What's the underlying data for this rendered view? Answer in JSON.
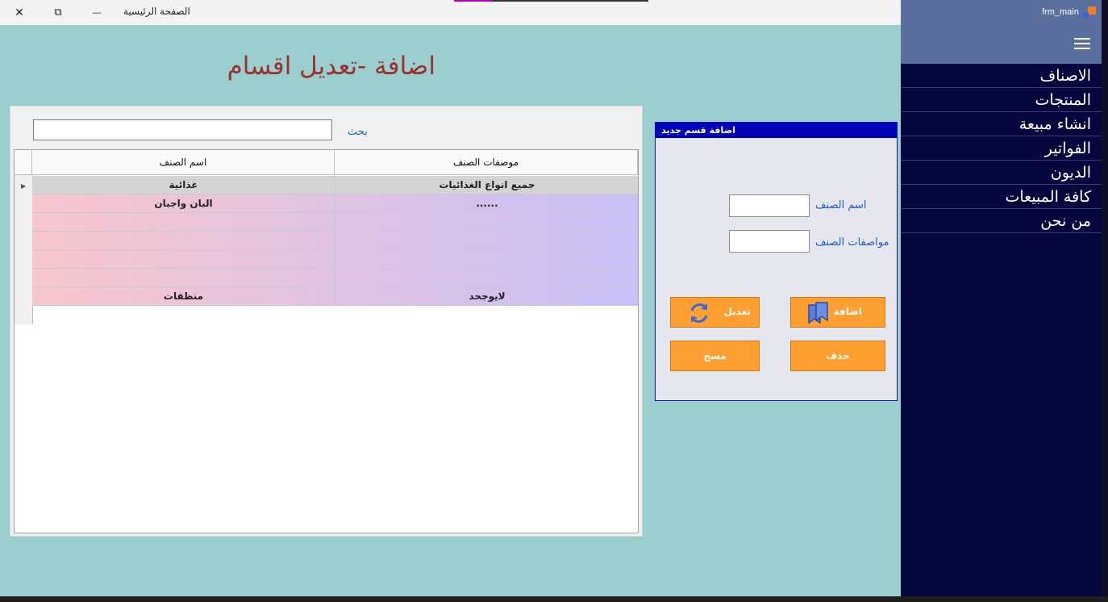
{
  "window": {
    "title": "الصفحة الرئيسية",
    "close_glyph": "✕",
    "restore_glyph": "⧉",
    "minimize_glyph": "—"
  },
  "sidebar": {
    "form_title": "frm_main",
    "menu_icon": "hamburger-icon",
    "items": [
      {
        "label": "الاصناف"
      },
      {
        "label": "المنتجات"
      },
      {
        "label": "انشاء مبيعة"
      },
      {
        "label": "الفواتير"
      },
      {
        "label": "الديون"
      },
      {
        "label": "كافة المبيعات"
      },
      {
        "label": "من نحن"
      }
    ]
  },
  "main": {
    "heading": "اضافة -تعديل اقسام",
    "search_label": "بحث",
    "search_value": "",
    "grid": {
      "columns": [
        "موصفات الصنف",
        "اسم الصنف"
      ],
      "rows": [
        {
          "description": "جميع انواع الغذائيات",
          "name": "غذائية",
          "selected": true
        },
        {
          "description": "......",
          "name": "البان واجبان"
        },
        {
          "description": "",
          "name": ""
        },
        {
          "description": "",
          "name": ""
        },
        {
          "description": "",
          "name": ""
        },
        {
          "description": "",
          "name": ""
        },
        {
          "description": "لايوجحد",
          "name": "منظفات"
        }
      ]
    }
  },
  "add_panel": {
    "title": "اضافة قسم جديد",
    "name_label": "اسم الصنف",
    "desc_label": "مواصفات الصنف",
    "name_value": "",
    "desc_value": "",
    "add_button": "اضافة",
    "edit_button": "تعديل",
    "delete_button": "حذف",
    "clear_button": "مسح"
  },
  "colors": {
    "background": "#9bcfcf",
    "sidebar": "#06063f",
    "heading": "#9b3030",
    "button": "#ff9f32",
    "panel_title": "#0000b8"
  }
}
